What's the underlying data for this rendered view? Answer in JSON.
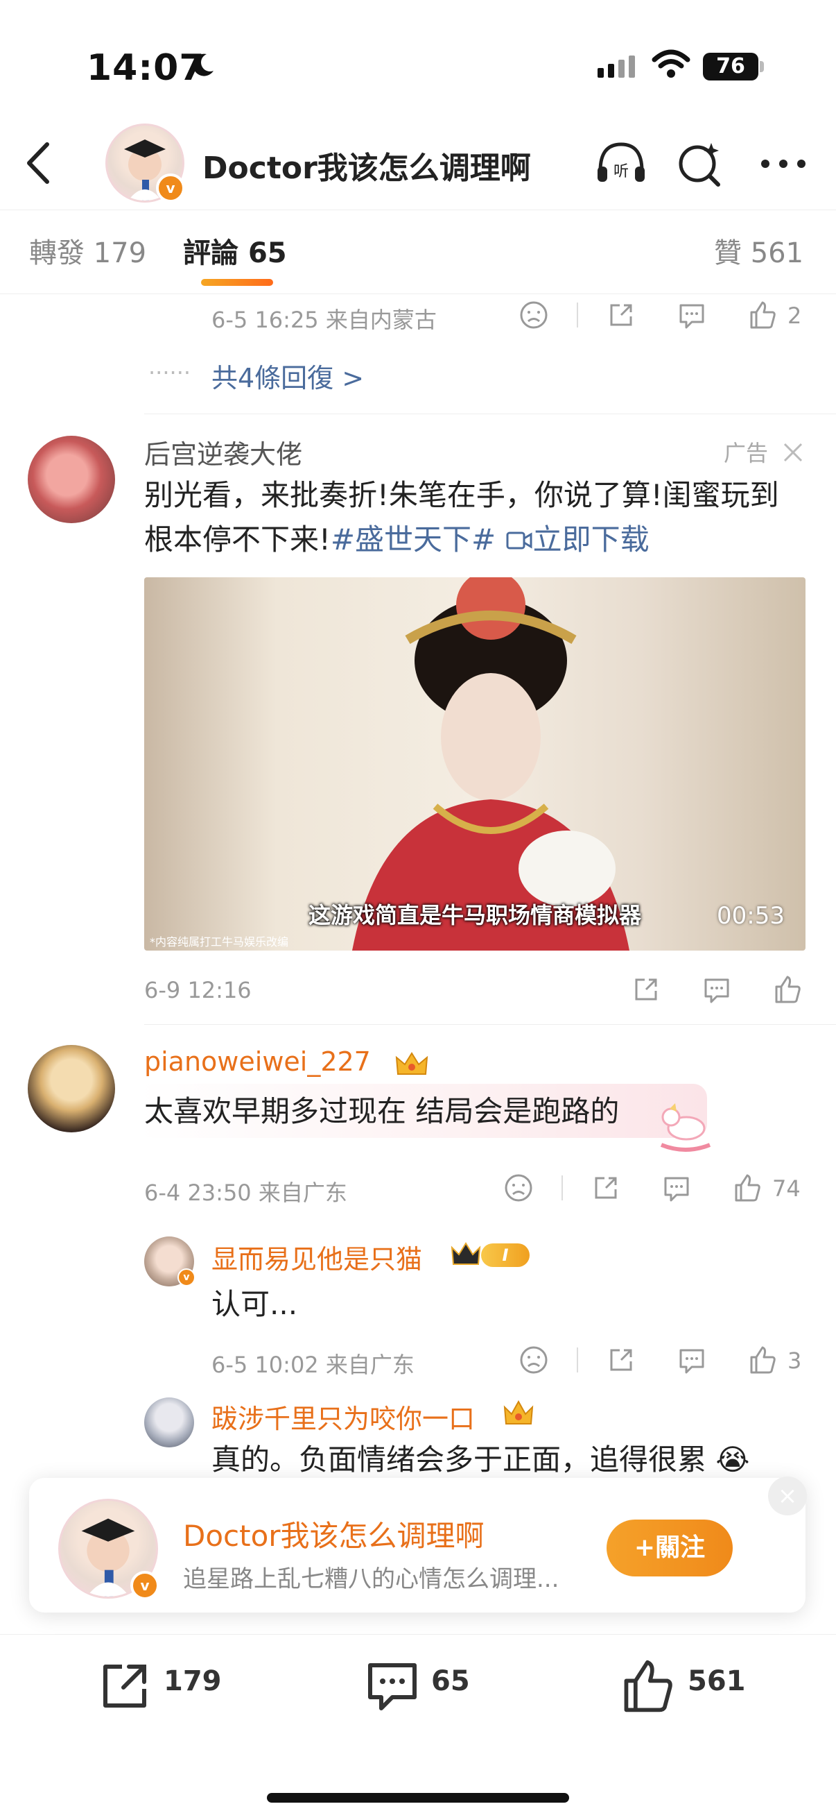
{
  "status": {
    "time": "14:07",
    "battery": "76"
  },
  "header": {
    "title": "Doctor我该怎么调理啊"
  },
  "tabs": {
    "repost_label": "轉發",
    "repost_count": "179",
    "comment_label": "評論",
    "comment_count": "65",
    "like_label": "贊",
    "like_count": "561"
  },
  "top_reply": {
    "meta": "6-5 16:25 来自内蒙古",
    "likes": "2",
    "more_replies": "共4條回復 >"
  },
  "ad": {
    "username": "后宫逆袭大佬",
    "ad_label": "广告",
    "text": "别光看，来批奏折!朱笔在手，你说了算!闺蜜玩到根本停不下来!",
    "hashtag": "#盛世天下#",
    "download": "立即下载",
    "video_caption": "这游戏简直是牛马职场情商模拟器",
    "video_duration": "00:53",
    "video_note": "*内容纯属打工牛马娱乐改编",
    "meta": "6-9 12:16"
  },
  "comment1": {
    "username": "pianoweiwei_227",
    "text": "太喜欢早期多过现在 结局会是跑路的",
    "meta": "6-4 23:50 来自广东",
    "likes": "74"
  },
  "reply1": {
    "username": "显而易见他是只猫",
    "level": "I",
    "text": "认可...",
    "meta": "6-5 10:02 来自广东",
    "likes": "3"
  },
  "reply2": {
    "username": "跋涉千里只为咬你一口",
    "text": "真的。负面情绪会多于正面，追得很累",
    "emoji": "😭"
  },
  "follow_card": {
    "name": "Doctor我该怎么调理啊",
    "desc": "追星路上乱七糟八的心情怎么调理...",
    "button": "+關注"
  },
  "bottom": {
    "repost": "179",
    "comment": "65",
    "like": "561"
  },
  "colors": {
    "accent": "#f08a1a",
    "username": "#e8701a",
    "link": "#4a6b9c"
  }
}
